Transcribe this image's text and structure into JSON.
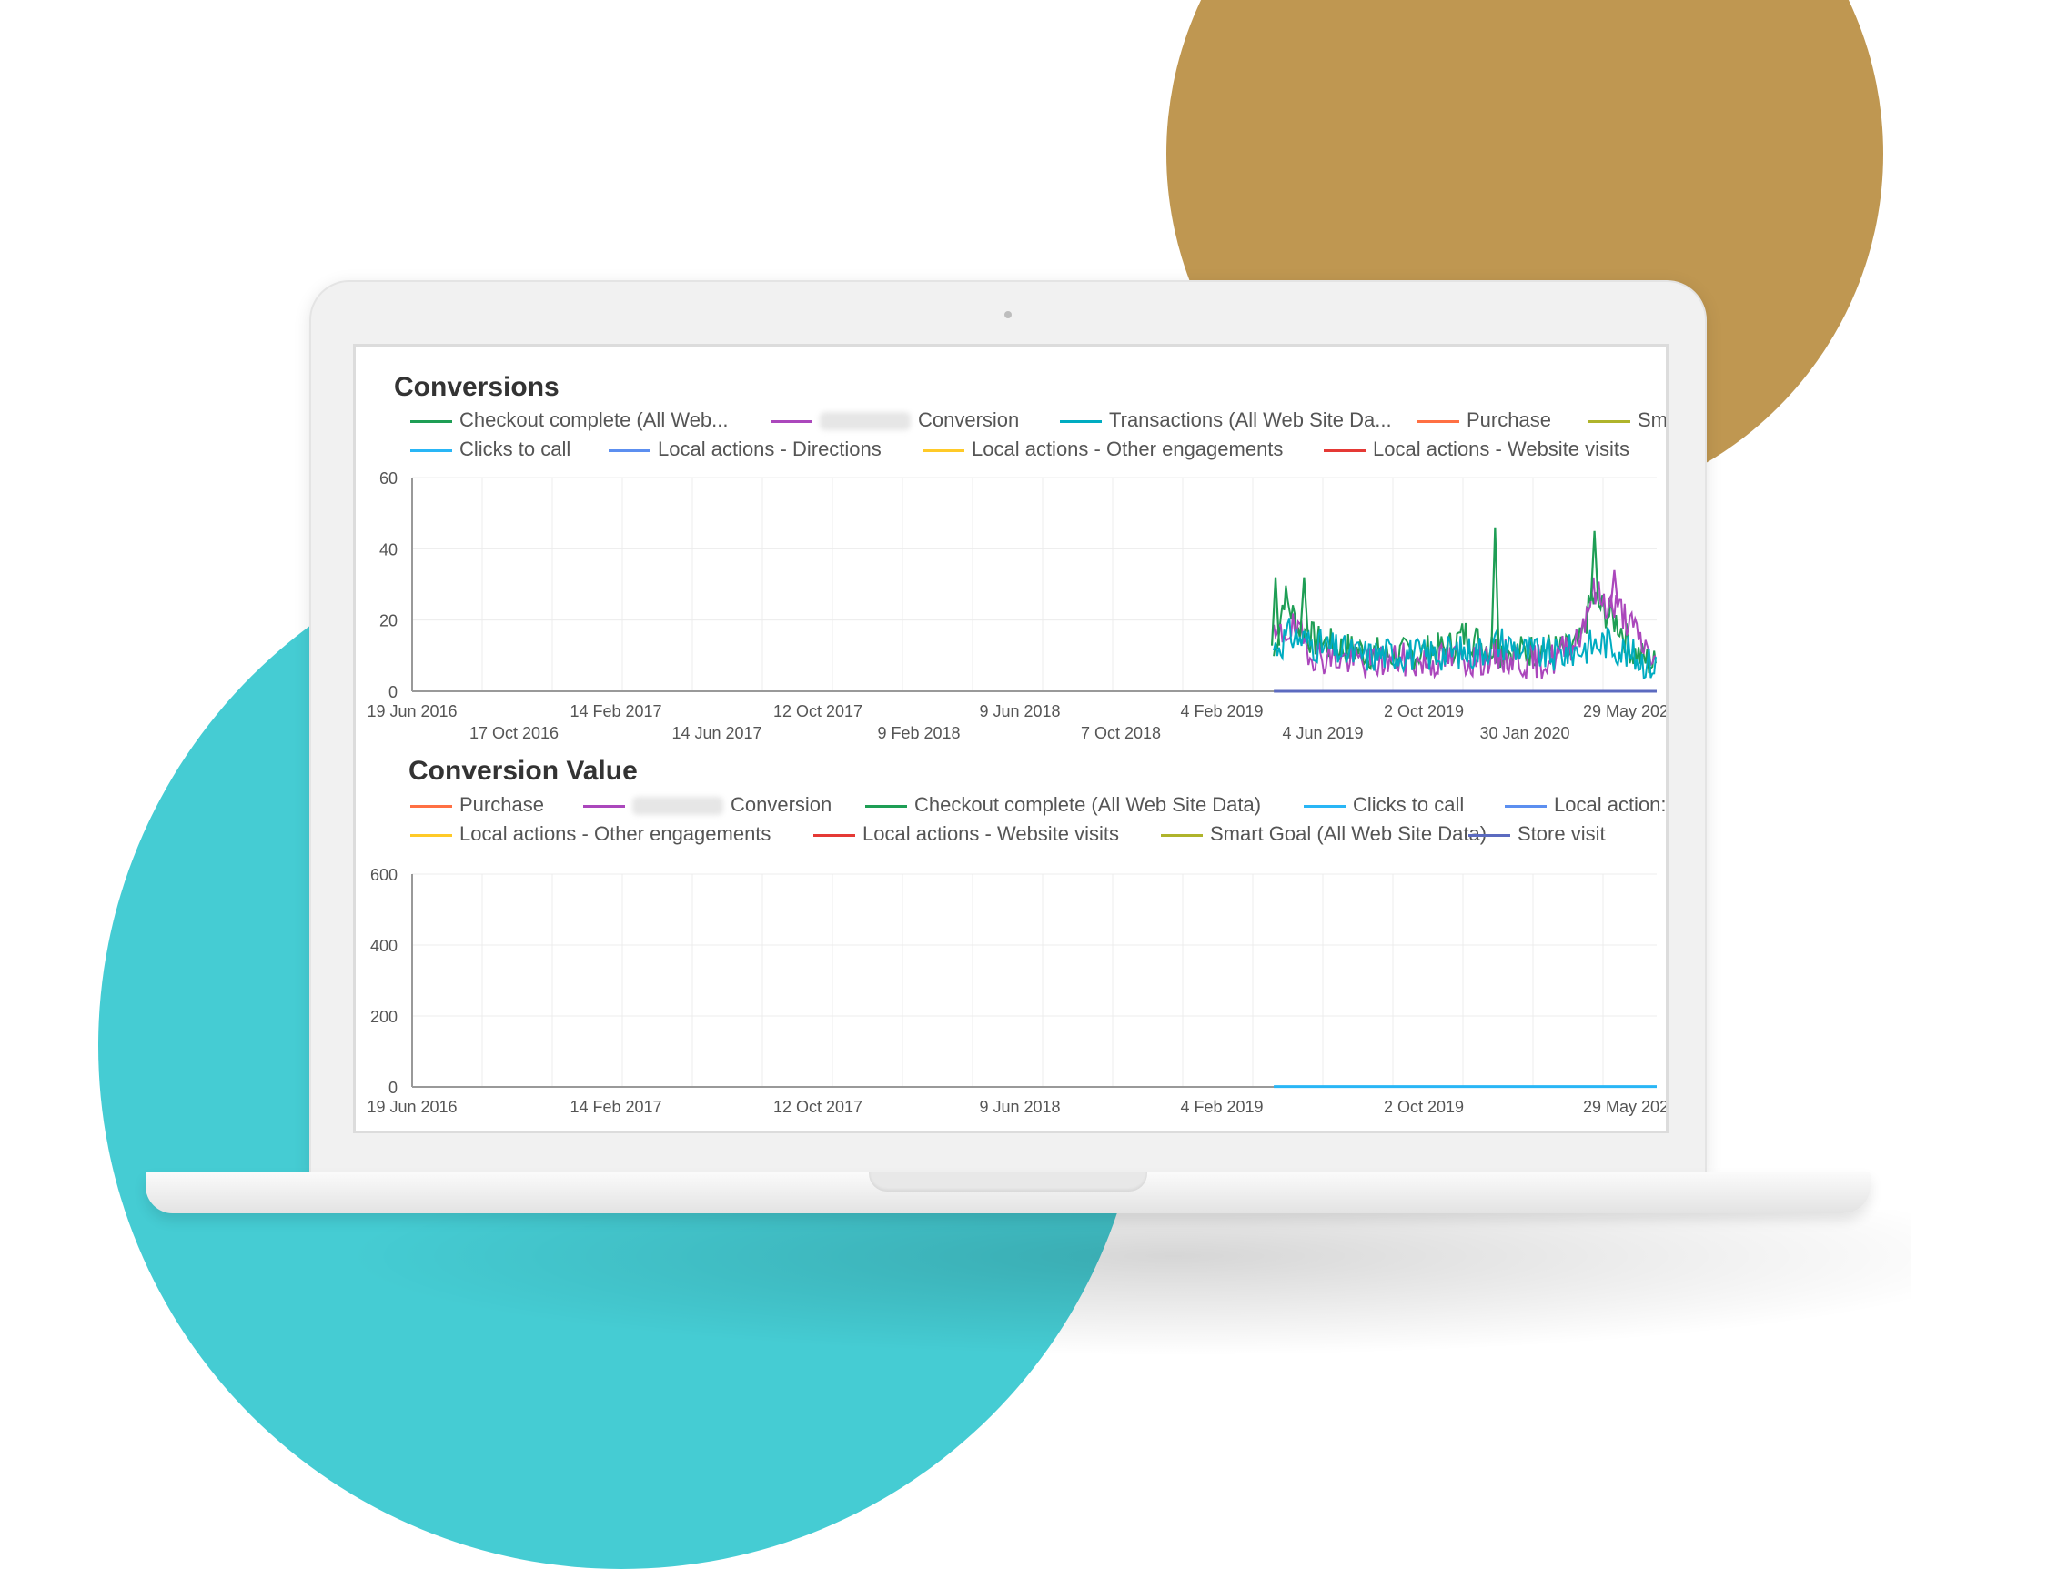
{
  "chart_data": [
    {
      "type": "line",
      "title": "Conversions",
      "legend": [
        {
          "name": "Checkout complete (All Web...",
          "color": "#1e9e55"
        },
        {
          "name": "Conversion",
          "color": "#ab47bc",
          "redacted_prefix": true
        },
        {
          "name": "Transactions (All Web Site Da...",
          "color": "#00acc1"
        },
        {
          "name": "Purchase",
          "color": "#ff7043"
        },
        {
          "name": "Sm",
          "color": "#afb42b"
        },
        {
          "name": "Clicks to call",
          "color": "#29b6f6"
        },
        {
          "name": "Local actions - Directions",
          "color": "#5c8ff0"
        },
        {
          "name": "Local actions - Other engagements",
          "color": "#ffca28"
        },
        {
          "name": "Local actions - Website visits",
          "color": "#e53935"
        }
      ],
      "x_range": [
        "2016-06-19",
        "2020-05-29"
      ],
      "ylim": [
        0,
        60
      ],
      "y_ticks": [
        0,
        20,
        40,
        60
      ],
      "x_ticks_row1": [
        "19 Jun 2016",
        "14 Feb 2017",
        "12 Oct 2017",
        "9 Jun 2018",
        "4 Feb 2019",
        "2 Oct 2019",
        "29 May 202"
      ],
      "x_ticks_row2": [
        "17 Oct 2016",
        "14 Jun 2017",
        "9 Feb 2018",
        "7 Oct 2018",
        "4 Jun 2019",
        "30 Jan 2020"
      ],
      "grid": true,
      "legend_position": "top",
      "data_start": "2019-03-13",
      "series": [
        {
          "name": "Checkout complete (All Web...",
          "color": "#1e9e55",
          "anchors_x": [
            "2019-03-13",
            "2019-03-25",
            "2019-04-10",
            "2019-05-01",
            "2019-06-01",
            "2019-07-01",
            "2019-08-01",
            "2019-09-01",
            "2019-10-01",
            "2019-10-20",
            "2019-11-20",
            "2019-12-20",
            "2020-01-20",
            "2020-02-15",
            "2020-03-01",
            "2020-03-15",
            "2020-04-01",
            "2020-04-15",
            "2020-05-01",
            "2020-05-29"
          ],
          "anchors_y": [
            10,
            27,
            18,
            14,
            12,
            11,
            10,
            11,
            12,
            16,
            12,
            11,
            12,
            11,
            13,
            26,
            22,
            19,
            11,
            7
          ]
        },
        {
          "name": "Conversion",
          "color": "#ab47bc",
          "anchors_x": [
            "2019-03-13",
            "2019-04-01",
            "2019-05-01",
            "2019-06-01",
            "2019-07-01",
            "2019-08-01",
            "2019-09-01",
            "2019-10-01",
            "2019-11-01",
            "2019-12-01",
            "2020-01-01",
            "2020-02-01",
            "2020-03-01",
            "2020-03-15",
            "2020-04-01",
            "2020-04-20",
            "2020-05-10",
            "2020-05-29"
          ],
          "anchors_y": [
            14,
            18,
            10,
            9,
            8,
            9,
            8,
            9,
            9,
            10,
            8,
            9,
            16,
            28,
            25,
            22,
            14,
            8
          ]
        },
        {
          "name": "Transactions (All Web Site Da...",
          "color": "#00acc1",
          "anchors_x": [
            "2019-03-13",
            "2019-04-01",
            "2019-05-01",
            "2019-06-01",
            "2019-07-01",
            "2019-08-01",
            "2019-09-01",
            "2019-10-01",
            "2019-11-01",
            "2019-12-01",
            "2020-01-01",
            "2020-02-01",
            "2020-03-01",
            "2020-04-01",
            "2020-05-01",
            "2020-05-29"
          ],
          "anchors_y": [
            12,
            16,
            13,
            11,
            10,
            11,
            10,
            11,
            11,
            14,
            11,
            10,
            12,
            14,
            10,
            7
          ]
        }
      ],
      "spikes": [
        {
          "date": "2019-03-15",
          "value": 32,
          "series": "Checkout complete (All Web..."
        },
        {
          "date": "2019-04-17",
          "value": 32,
          "series": "Checkout complete (All Web..."
        },
        {
          "date": "2019-11-24",
          "value": 46,
          "series": "Checkout complete (All Web..."
        },
        {
          "date": "2020-03-18",
          "value": 45,
          "series": "Checkout complete (All Web..."
        },
        {
          "date": "2020-04-10",
          "value": 34,
          "series": "Conversion"
        }
      ]
    },
    {
      "type": "line",
      "title": "Conversion Value",
      "legend": [
        {
          "name": "Purchase",
          "color": "#ff7043"
        },
        {
          "name": "Conversion",
          "color": "#ab47bc",
          "redacted_prefix": true
        },
        {
          "name": "Checkout complete (All Web Site Data)",
          "color": "#1e9e55"
        },
        {
          "name": "Clicks to call",
          "color": "#29b6f6"
        },
        {
          "name": "Local action:",
          "color": "#5c8ff0"
        },
        {
          "name": "Local actions - Other engagements",
          "color": "#ffca28"
        },
        {
          "name": "Local actions - Website visits",
          "color": "#e53935"
        },
        {
          "name": "Smart Goal (All Web Site Data)",
          "color": "#afb42b"
        },
        {
          "name": "Store visit",
          "color": "#5c6bc0"
        }
      ],
      "x_range": [
        "2016-06-19",
        "2020-05-29"
      ],
      "ylim": [
        0,
        600
      ],
      "y_ticks": [
        0,
        200,
        400,
        600
      ],
      "x_ticks_row1": [
        "19 Jun 2016",
        "14 Feb 2017",
        "12 Oct 2017",
        "9 Jun 2018",
        "4 Feb 2019",
        "2 Oct 2019",
        "29 May 202"
      ],
      "grid": true,
      "legend_position": "top",
      "series": [
        {
          "name": "Checkout complete (All Web Site Data)",
          "color": "#29b6f6",
          "x": [
            "2019-03-13",
            "2020-05-29"
          ],
          "y": [
            1,
            1
          ]
        }
      ]
    }
  ]
}
